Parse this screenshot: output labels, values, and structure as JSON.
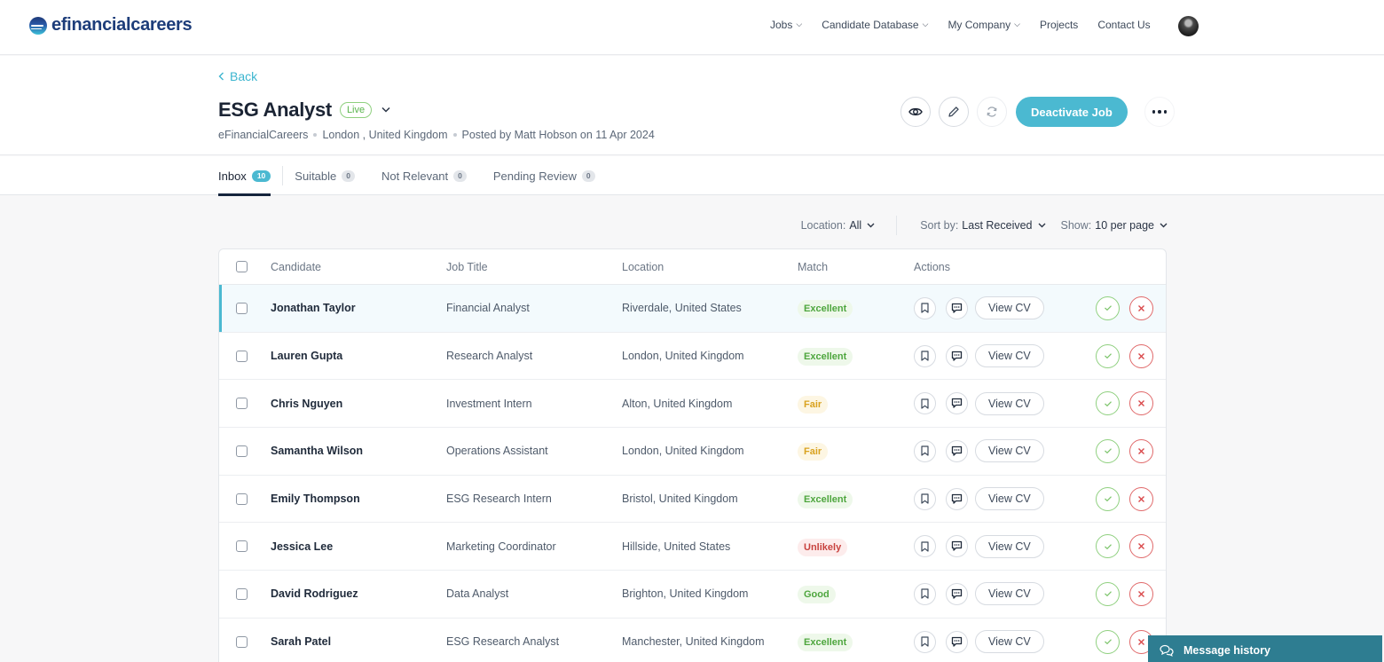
{
  "brand": {
    "name": "efinancialcareers",
    "accent": "#4bb9d1"
  },
  "nav": {
    "items": [
      {
        "label": "Jobs",
        "dropdown": true
      },
      {
        "label": "Candidate Database",
        "dropdown": true
      },
      {
        "label": "My Company",
        "dropdown": true
      },
      {
        "label": "Projects",
        "dropdown": false
      },
      {
        "label": "Contact Us",
        "dropdown": false
      }
    ],
    "avatar_icon": "user-avatar"
  },
  "job": {
    "back_label": "Back",
    "title": "ESG Analyst",
    "status": "Live",
    "company": "eFinancialCareers",
    "location": "London , United Kingdom",
    "posted": "Posted by Matt Hobson on 11 Apr 2024",
    "actions": {
      "preview_icon": "eye-icon",
      "edit_icon": "pencil-icon",
      "refresh_icon": "refresh-icon",
      "deactivate_label": "Deactivate Job",
      "more_icon": "more-icon"
    }
  },
  "tabs": [
    {
      "label": "Inbox",
      "count": "10",
      "active": true
    },
    {
      "label": "Suitable",
      "count": "0",
      "active": false
    },
    {
      "label": "Not Relevant",
      "count": "0",
      "active": false
    },
    {
      "label": "Pending Review",
      "count": "0",
      "active": false
    }
  ],
  "filters": {
    "location": {
      "label": "Location:",
      "value": "All"
    },
    "sort": {
      "label": "Sort by:",
      "value": "Last Received"
    },
    "show": {
      "label": "Show:",
      "value": "10 per page"
    }
  },
  "table": {
    "headers": {
      "candidate": "Candidate",
      "job_title": "Job Title",
      "location": "Location",
      "match": "Match",
      "actions": "Actions"
    },
    "view_cv_label": "View CV",
    "rows": [
      {
        "name": "Jonathan Taylor",
        "job_title": "Financial Analyst",
        "location": "Riverdale, United States",
        "match": "Excellent",
        "selected": true
      },
      {
        "name": "Lauren Gupta",
        "job_title": "Research Analyst",
        "location": "London, United Kingdom",
        "match": "Excellent",
        "selected": false
      },
      {
        "name": "Chris Nguyen",
        "job_title": "Investment Intern",
        "location": "Alton, United Kingdom",
        "match": "Fair",
        "selected": false
      },
      {
        "name": "Samantha Wilson",
        "job_title": "Operations Assistant",
        "location": "London, United Kingdom",
        "match": "Fair",
        "selected": false
      },
      {
        "name": "Emily Thompson",
        "job_title": "ESG Research Intern",
        "location": "Bristol, United Kingdom",
        "match": "Excellent",
        "selected": false
      },
      {
        "name": "Jessica Lee",
        "job_title": "Marketing Coordinator",
        "location": "Hillside, United States",
        "match": "Unlikely",
        "selected": false
      },
      {
        "name": "David Rodriguez",
        "job_title": "Data Analyst",
        "location": "Brighton, United Kingdom",
        "match": "Good",
        "selected": false
      },
      {
        "name": "Sarah Patel",
        "job_title": "ESG Research Analyst",
        "location": "Manchester, United Kingdom",
        "match": "Excellent",
        "selected": false
      }
    ]
  },
  "message_history": {
    "label": "Message history",
    "icon": "chat-bubbles-icon"
  }
}
